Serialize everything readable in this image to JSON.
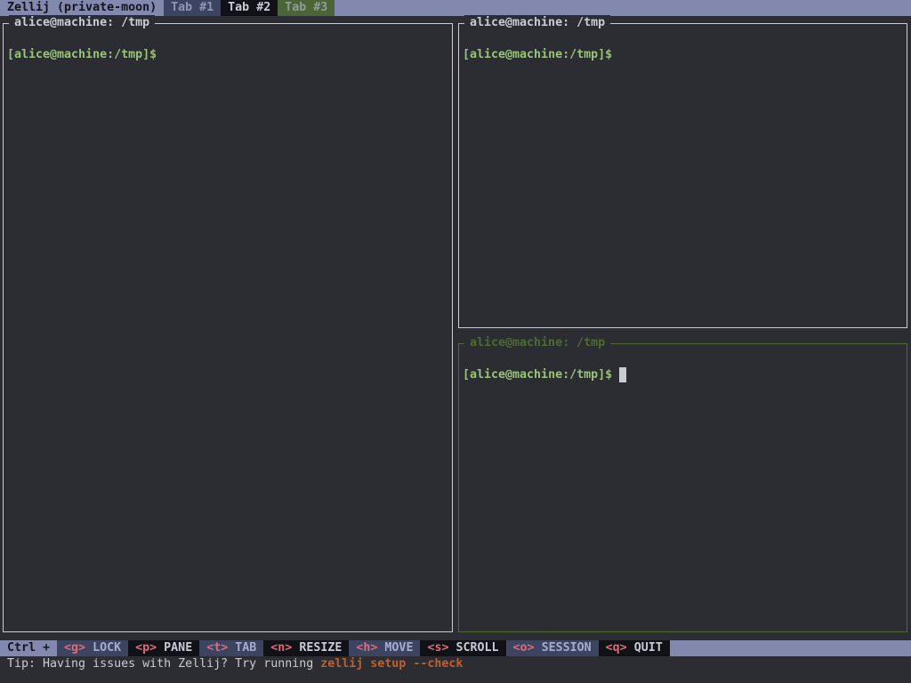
{
  "top_bar": {
    "session_title": "Zellij (private-moon)",
    "tabs": [
      {
        "label": "Tab #1"
      },
      {
        "label": "Tab #2"
      },
      {
        "label": "Tab #3"
      }
    ]
  },
  "panes": [
    {
      "title": "alice@machine: /tmp",
      "prompt": "[alice@machine:/tmp]$",
      "focused": false
    },
    {
      "title": "alice@machine: /tmp",
      "prompt": "[alice@machine:/tmp]$",
      "focused": false
    },
    {
      "title": "alice@machine: /tmp",
      "prompt": "[alice@machine:/tmp]$",
      "focused": true
    }
  ],
  "status_bar": {
    "prefix": "Ctrl +",
    "items": [
      {
        "key": "<g>",
        "label": "LOCK"
      },
      {
        "key": "<p>",
        "label": "PANE"
      },
      {
        "key": "<t>",
        "label": "TAB"
      },
      {
        "key": "<n>",
        "label": "RESIZE"
      },
      {
        "key": "<h>",
        "label": "MOVE"
      },
      {
        "key": "<s>",
        "label": "SCROLL"
      },
      {
        "key": "<o>",
        "label": "SESSION"
      },
      {
        "key": "<q>",
        "label": "QUIT"
      }
    ]
  },
  "tip": {
    "text": "Tip: Having issues with Zellij? Try running ",
    "command": "zellij setup --check"
  }
}
